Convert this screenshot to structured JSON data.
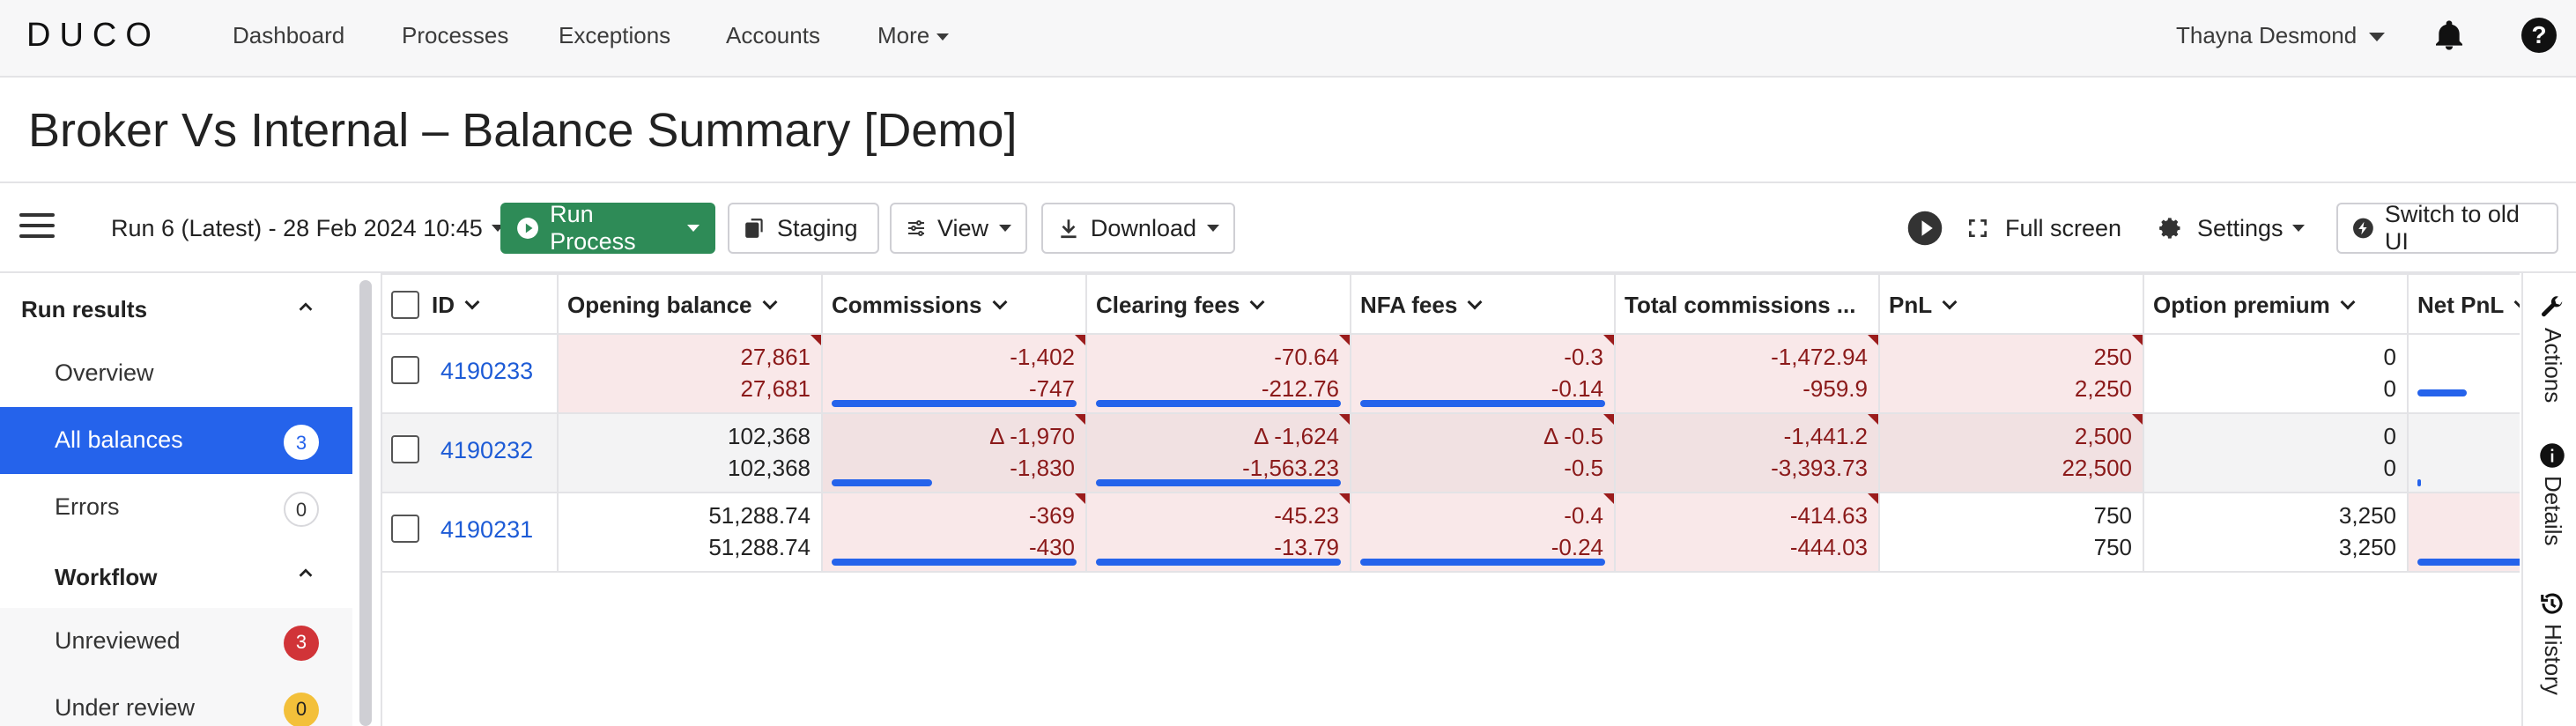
{
  "nav": {
    "logo": "DUCO",
    "links": [
      "Dashboard",
      "Processes",
      "Exceptions",
      "Accounts",
      "More"
    ],
    "user": "Thayna Desmond"
  },
  "page": {
    "title": "Broker Vs Internal – Balance Summary [Demo]"
  },
  "toolbar": {
    "run_select": "Run 6 (Latest) - 28 Feb 2024 10:45",
    "run_process": "Run Process",
    "staging": "Staging",
    "view": "View",
    "download": "Download",
    "full_screen": "Full screen",
    "settings": "Settings",
    "switch_ui": "Switch to old UI"
  },
  "sidebar": {
    "run_results": "Run results",
    "overview": "Overview",
    "all_balances": "All balances",
    "all_balances_count": "3",
    "errors": "Errors",
    "errors_count": "0",
    "workflow": "Workflow",
    "unreviewed": "Unreviewed",
    "unreviewed_count": "3",
    "under_review": "Under review",
    "under_review_count": "0"
  },
  "grid": {
    "columns": [
      "ID",
      "Opening balance",
      "Commissions",
      "Clearing fees",
      "NFA fees",
      "Total commissions ...",
      "PnL",
      "Option premium",
      "Net PnL"
    ],
    "rows": [
      {
        "id": "4190233",
        "opening": [
          "27,861",
          "27,681"
        ],
        "commissions": [
          "-1,402",
          "-747"
        ],
        "clearing": [
          "-70.64",
          "-212.76"
        ],
        "nfa": [
          "-0.3",
          "-0.14"
        ],
        "total": [
          "-1,472.94",
          "-959.9"
        ],
        "pnl": [
          "250",
          "2,250"
        ],
        "option": [
          "0",
          "0"
        ]
      },
      {
        "id": "4190232",
        "opening": [
          "102,368",
          "102,368"
        ],
        "commissions": [
          "Δ -1,970",
          "-1,830"
        ],
        "clearing": [
          "Δ -1,624",
          "-1,563.23"
        ],
        "nfa": [
          "Δ -0.5",
          "-0.5"
        ],
        "total": [
          "-1,441.2",
          "-3,393.73"
        ],
        "pnl": [
          "2,500",
          "22,500"
        ],
        "option": [
          "0",
          "0"
        ]
      },
      {
        "id": "4190231",
        "opening": [
          "51,288.74",
          "51,288.74"
        ],
        "commissions": [
          "-369",
          "-430"
        ],
        "clearing": [
          "-45.23",
          "-13.79"
        ],
        "nfa": [
          "-0.4",
          "-0.24"
        ],
        "total": [
          "-414.63",
          "-444.03"
        ],
        "pnl": [
          "750",
          "750"
        ],
        "option": [
          "3,250",
          "3,250"
        ]
      }
    ]
  },
  "rail": {
    "actions": "Actions",
    "details": "Details",
    "history": "History"
  },
  "colors": {
    "accent": "#2563eb",
    "run": "#2e8b57",
    "break_text": "#8b1a1a",
    "break_bg": "#f9e8e9"
  }
}
